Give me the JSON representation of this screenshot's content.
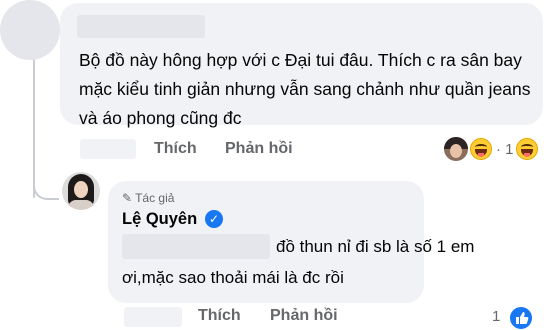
{
  "comment": {
    "text": "Bộ đồ này hông hợp với c Đại tui đâu. Thích c ra sân bay mặc kiểu tinh giản nhưng vẫn sang chảnh như quần jeans và áo phong cũng đc",
    "actions": {
      "like": "Thích",
      "reply": "Phản hồi"
    },
    "reaction_count": "· 1",
    "reaction_icon": "laughing-emoji-icon"
  },
  "reply": {
    "author_tag": "Tác giả",
    "author_name": "Lệ Quyên",
    "verified_icon": "verified-badge-icon",
    "text_line1": "đồ thun nỉ đi sb là số 1 em",
    "text_line2": "ơi,mặc sao thoải mái là đc rồi",
    "actions": {
      "like": "Thích",
      "reply": "Phản hồi"
    },
    "like_count": "1",
    "like_icon": "like-thumb-icon"
  },
  "colors": {
    "bubble": "#f0f2f5",
    "text": "#050505",
    "muted": "#65676b",
    "accent": "#1877f2"
  }
}
